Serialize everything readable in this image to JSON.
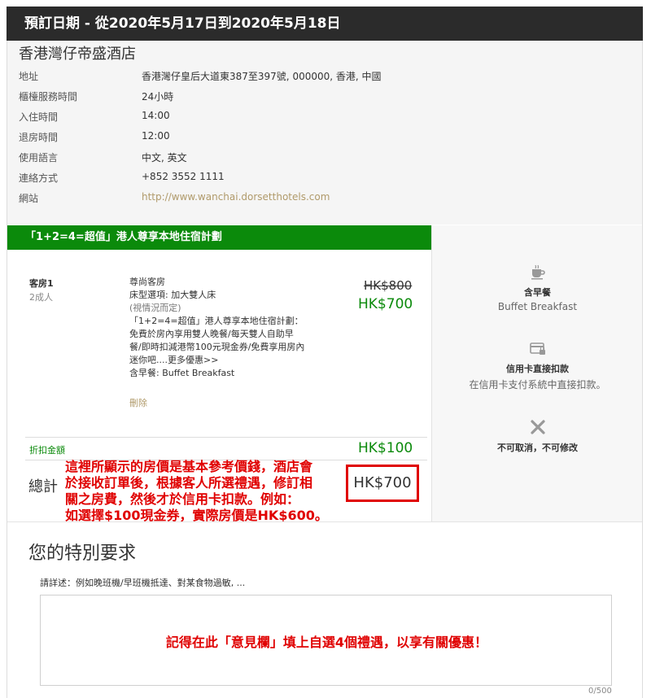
{
  "booking": {
    "dates_header": "預訂日期 - 從2020年5月17日到2020年5月18日"
  },
  "hotel": {
    "name": "香港灣仔帝盛酒店",
    "rows": [
      {
        "label": "地址",
        "value": "香港灣仔皇后大道東387至397號, 000000, 香港, 中國"
      },
      {
        "label": "櫃檯服務時間",
        "value": "24小時"
      },
      {
        "label": "入住時間",
        "value": "14:00"
      },
      {
        "label": "退房時間",
        "value": "12:00"
      },
      {
        "label": "使用語言",
        "value": "中文, 英文"
      },
      {
        "label": "連絡方式",
        "value": "+852 3552 1111"
      },
      {
        "label": "網站",
        "value": "http://www.wanchai.dorsetthotels.com"
      }
    ]
  },
  "deal": {
    "title": "「1+2=4=超值」港人尊享本地住宿計劃"
  },
  "room": {
    "label": "客房1",
    "guests": "2成人",
    "type": "尊尚客房",
    "bed": "床型選項: 加大雙人床",
    "bed_note": "(視情況而定)",
    "desc1": "「1+2=4=超值」港人尊享本地住宿計劃：",
    "desc2": "免費於房內享用雙人晚餐/每天雙人自助早",
    "desc3": "餐/即時扣減港幣100元現金券/免費享用房內",
    "desc4": "迷你吧....更多優惠>>",
    "breakfast": "含早餐: Buffet Breakfast",
    "delete": "刪除",
    "old_price": "HK$800",
    "new_price": "HK$700"
  },
  "discount": {
    "label": "折扣金額",
    "value": "HK$100"
  },
  "total": {
    "label": "總計",
    "value": "HK$700"
  },
  "annotation": {
    "line1": "這裡所顯示的房價是基本參考價錢，酒店會",
    "line2": "於接收訂單後，根據客人所選禮遇，修訂相",
    "line3": "關之房費，然後才於信用卡扣款。例如：",
    "line4": "如選擇$100現金券，實際房價是HK$600。"
  },
  "features": [
    {
      "icon": "coffee-cup-icon",
      "title": "含早餐",
      "sub": "Buffet Breakfast"
    },
    {
      "icon": "credit-card-lock-icon",
      "title": "信用卡直接扣款",
      "sub": "在信用卡支付系統中直接扣款。"
    },
    {
      "icon": "close-x-icon",
      "title": "不可取消，不可修改",
      "sub": ""
    }
  ],
  "special": {
    "title": "您的特別要求",
    "hint": "請詳述：例如晚班機/早班機抵達、對某食物過敏, ...",
    "textarea_note": "記得在此「意見欄」填上自選4個禮遇，以享有關優惠！",
    "char_count": "0/500"
  },
  "colors": {
    "header_bg": "#2b2b2b",
    "deal_green": "#0b8a0b",
    "link_gold": "#b09a6a",
    "annotation_red": "#e00000"
  }
}
